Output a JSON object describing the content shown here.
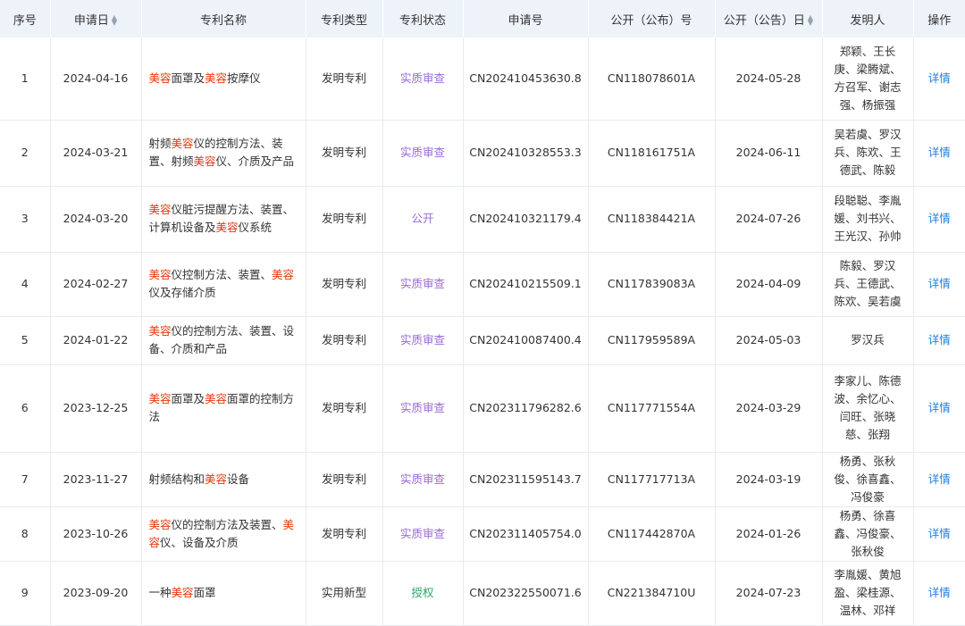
{
  "headers": {
    "seq": "序号",
    "apply_date": "申请日",
    "name": "专利名称",
    "type": "专利类型",
    "status": "专利状态",
    "apply_no": "申请号",
    "pub_no": "公开（公布）号",
    "pub_date": "公开（公告）日",
    "inventor": "发明人",
    "action": "操作"
  },
  "keyword": "美容",
  "colors": {
    "keyword": "#e8380d",
    "status_exam": "#9b6bd8",
    "status_grant": "#2fa36b",
    "link": "#1f7fe0",
    "header_bg": "#eef3fa"
  },
  "rows": [
    {
      "seq": "1",
      "apply_date": "2024-04-16",
      "name": "美容面罩及美容按摩仪",
      "type": "发明专利",
      "status": "实质审查",
      "apply_no": "CN202410453630.8",
      "pub_no": "CN118078601A",
      "pub_date": "2024-05-28",
      "inventor": "郑颖、王长庚、梁腾斌、方召军、谢志强、杨振强",
      "action": "详情"
    },
    {
      "seq": "2",
      "apply_date": "2024-03-21",
      "name": "射频美容仪的控制方法、装置、射频美容仪、介质及产品",
      "type": "发明专利",
      "status": "实质审查",
      "apply_no": "CN202410328553.3",
      "pub_no": "CN118161751A",
      "pub_date": "2024-06-11",
      "inventor": "吴若虞、罗汉兵、陈欢、王德武、陈毅",
      "action": "详情"
    },
    {
      "seq": "3",
      "apply_date": "2024-03-20",
      "name": "美容仪脏污提醒方法、装置、计算机设备及美容仪系统",
      "type": "发明专利",
      "status": "公开",
      "apply_no": "CN202410321179.4",
      "pub_no": "CN118384421A",
      "pub_date": "2024-07-26",
      "inventor": "段聪聪、李胤媛、刘书兴、王光汉、孙帅",
      "action": "详情"
    },
    {
      "seq": "4",
      "apply_date": "2024-02-27",
      "name": "美容仪控制方法、装置、美容仪及存储介质",
      "type": "发明专利",
      "status": "实质审查",
      "apply_no": "CN202410215509.1",
      "pub_no": "CN117839083A",
      "pub_date": "2024-04-09",
      "inventor": "陈毅、罗汉兵、王德武、陈欢、吴若虞",
      "action": "详情"
    },
    {
      "seq": "5",
      "apply_date": "2024-01-22",
      "name": "美容仪的控制方法、装置、设备、介质和产品",
      "type": "发明专利",
      "status": "实质审查",
      "apply_no": "CN202410087400.4",
      "pub_no": "CN117959589A",
      "pub_date": "2024-05-03",
      "inventor": "罗汉兵",
      "action": "详情"
    },
    {
      "seq": "6",
      "apply_date": "2023-12-25",
      "name": "美容面罩及美容面罩的控制方法",
      "type": "发明专利",
      "status": "实质审查",
      "apply_no": "CN202311796282.6",
      "pub_no": "CN117771554A",
      "pub_date": "2024-03-29",
      "inventor": "李家儿、陈德波、余忆心、闫旺、张晓慈、张翔",
      "action": "详情"
    },
    {
      "seq": "7",
      "apply_date": "2023-11-27",
      "name": "射频结构和美容设备",
      "type": "发明专利",
      "status": "实质审查",
      "apply_no": "CN202311595143.7",
      "pub_no": "CN117717713A",
      "pub_date": "2024-03-19",
      "inventor": "杨勇、张秋俊、徐喜鑫、冯俊豪",
      "action": "详情"
    },
    {
      "seq": "8",
      "apply_date": "2023-10-26",
      "name": "美容仪的控制方法及装置、美容仪、设备及介质",
      "type": "发明专利",
      "status": "实质审查",
      "apply_no": "CN202311405754.0",
      "pub_no": "CN117442870A",
      "pub_date": "2024-01-26",
      "inventor": "杨勇、徐喜鑫、冯俊豪、张秋俊",
      "action": "详情"
    },
    {
      "seq": "9",
      "apply_date": "2023-09-20",
      "name": "一种美容面罩",
      "type": "实用新型",
      "status": "授权",
      "apply_no": "CN202322550071.6",
      "pub_no": "CN221384710U",
      "pub_date": "2024-07-23",
      "inventor": "李胤媛、黄旭盈、梁桂源、温林、邓祥",
      "action": "详情"
    }
  ]
}
